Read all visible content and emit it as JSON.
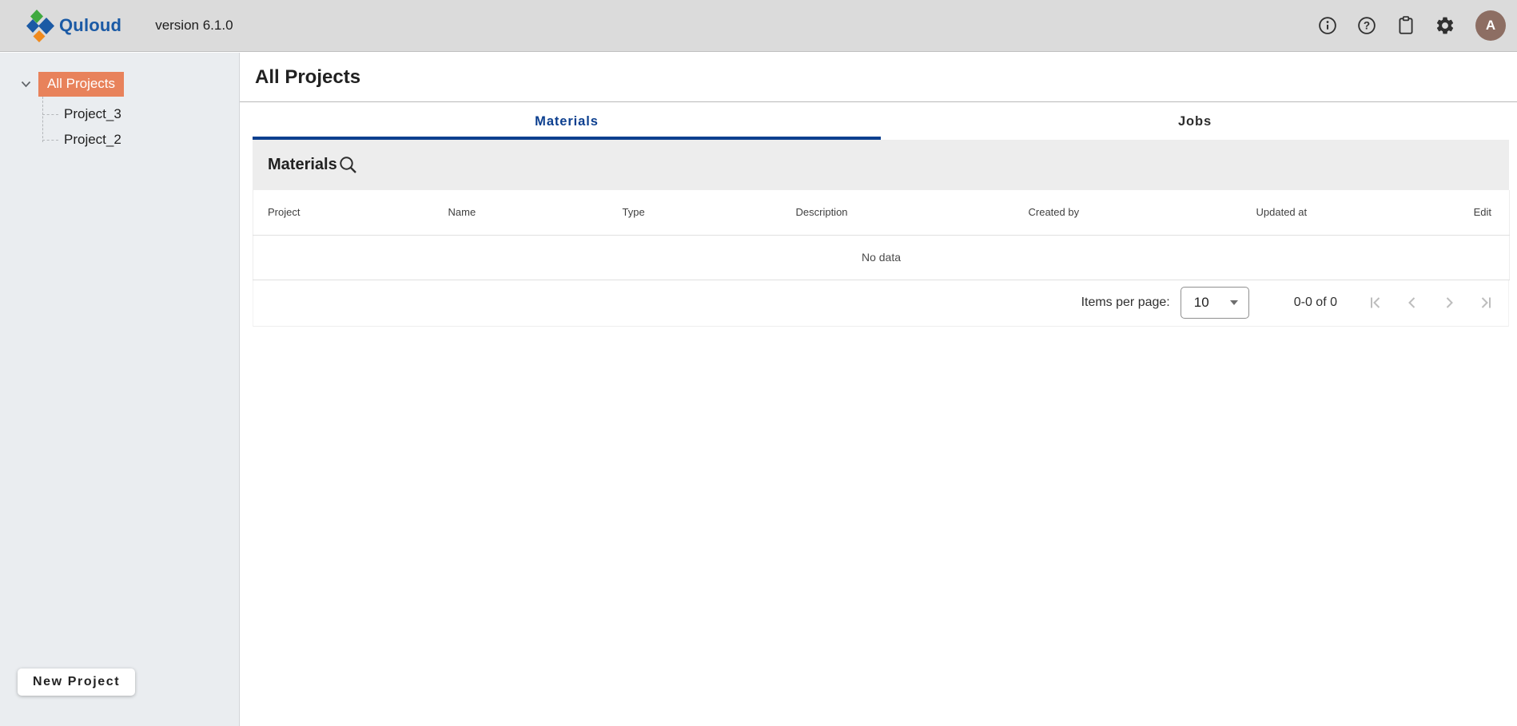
{
  "topbar": {
    "brand": "Quloud",
    "version": "version 6.1.0",
    "avatar_initial": "A"
  },
  "sidebar": {
    "tree": {
      "root_label": "All Projects",
      "children": [
        {
          "label": "Project_3"
        },
        {
          "label": "Project_2"
        }
      ]
    },
    "new_project_label": "New Project"
  },
  "main": {
    "title": "All Projects",
    "tabs": [
      {
        "label": "Materials",
        "active": true
      },
      {
        "label": "Jobs",
        "active": false
      }
    ],
    "panel": {
      "title": "Materials",
      "table": {
        "columns": [
          "Project",
          "Name",
          "Type",
          "Description",
          "Created by",
          "Updated at",
          "Edit"
        ],
        "rows": [],
        "empty_text": "No data"
      },
      "pagination": {
        "items_per_page_label": "Items per page:",
        "items_per_page_value": "10",
        "range_text": "0-0 of 0"
      }
    }
  },
  "colors": {
    "selection_orange": "#E8825B",
    "brand_blue": "#1B5AA5",
    "active_tab_blue": "#0C3F8F",
    "avatar_brown": "#8D6E63",
    "logo_green": "#3FA93F",
    "logo_orange": "#F08A1D"
  }
}
